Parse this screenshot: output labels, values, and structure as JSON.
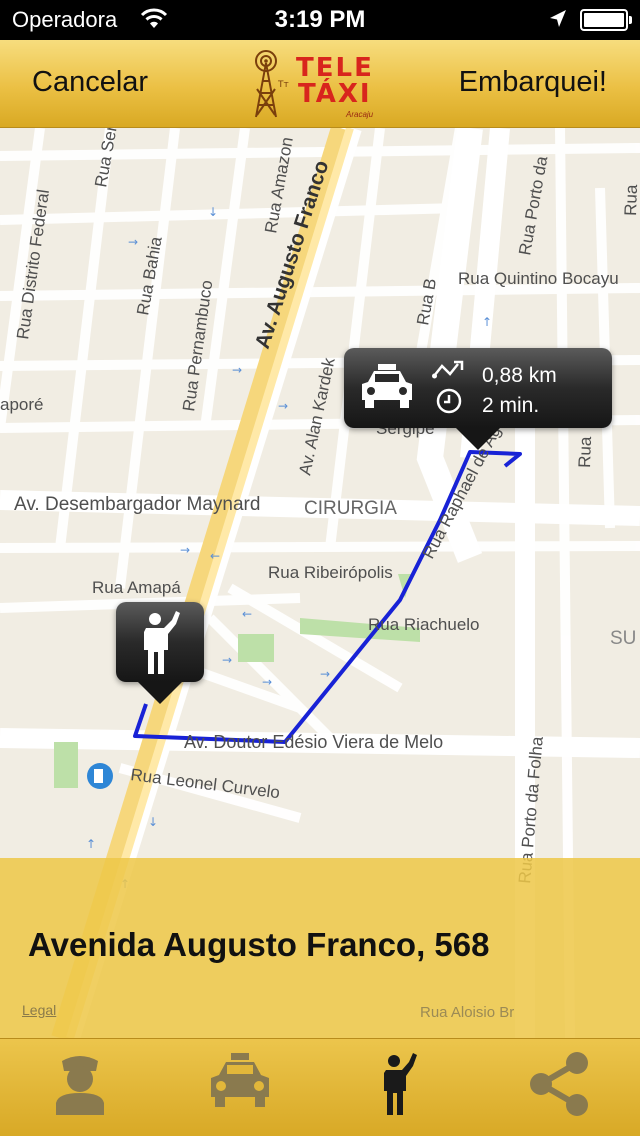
{
  "status_bar": {
    "carrier": "Operadora",
    "time": "3:19 PM"
  },
  "nav_bar": {
    "cancel_label": "Cancelar",
    "confirm_label": "Embarquei!",
    "logo": {
      "line1": "TELE",
      "line2": "TÁXI",
      "city": "Aracaju"
    }
  },
  "map": {
    "streets": [
      "Av. Augusto Franco",
      "Av. Desembargador Maynard",
      "CIRURGIA",
      "Rua Ribeirópolis",
      "Rua Riachuelo",
      "Rua Amapá",
      "Av. Doutor Edésio Viera de Melo",
      "Rua Leonel Curvelo",
      "Rua Quintino Bocayu",
      "Rua Porto da",
      "Rua Porto da Folha",
      "Rua Distrito Federal",
      "Rua Bahia",
      "Rua Pernambuco",
      "Rua Amazon",
      "Av. Alan Kardek",
      "Rua Raphael de Ag",
      "Rua B",
      "Rua Serg",
      "Sergipe",
      "aporé",
      "SU",
      "Rua",
      "Rua"
    ],
    "route_color": "#1822d6"
  },
  "taxi_callout": {
    "distance": "0,88 km",
    "duration": "2 min."
  },
  "address_panel": {
    "address": "Avenida Augusto Franco, 568",
    "legal": "Legal",
    "bg_street": "Rua Aloisio Br"
  },
  "tab_bar": {
    "tabs": [
      {
        "icon": "driver-icon",
        "active": false
      },
      {
        "icon": "taxi-icon",
        "active": false
      },
      {
        "icon": "hail-person-icon",
        "active": true
      },
      {
        "icon": "share-icon",
        "active": false
      }
    ]
  },
  "colors": {
    "gold": "#ebc044",
    "brand_red": "#d8251d",
    "route_blue": "#1822d6"
  }
}
